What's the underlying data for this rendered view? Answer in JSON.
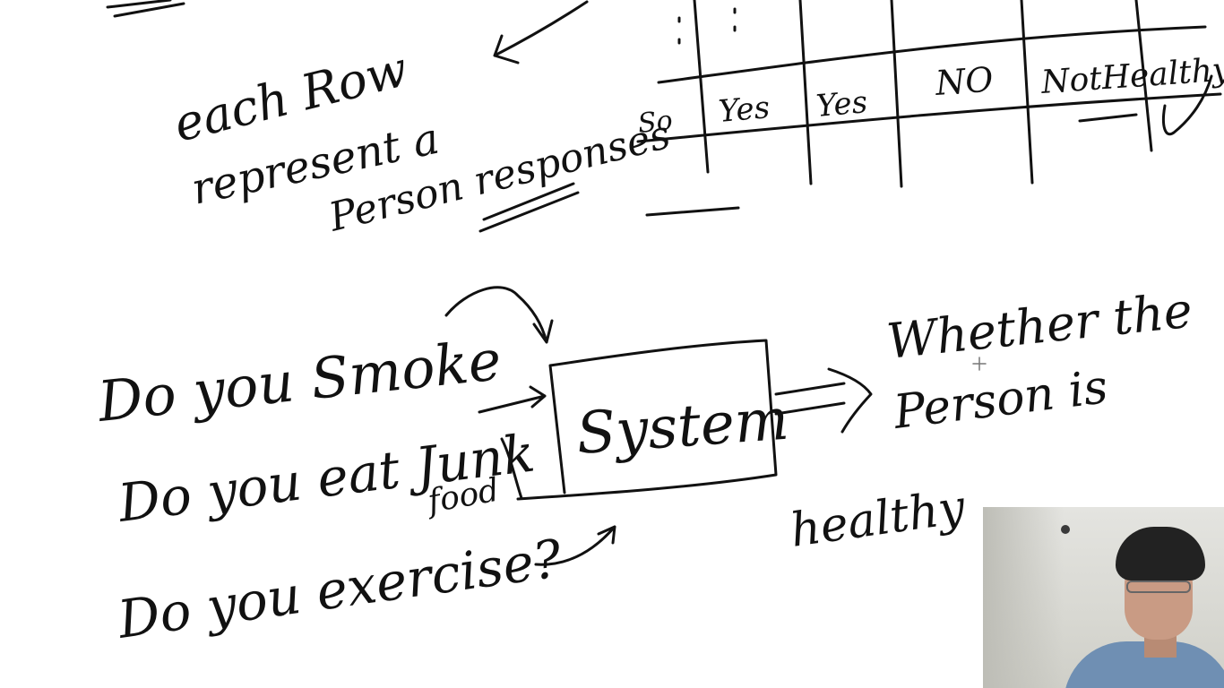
{
  "annotation": {
    "line1": "each Row",
    "line2": "represent a",
    "line3": "Person responses"
  },
  "table_row": [
    "So",
    "Yes",
    "Yes",
    "NO",
    "NotHealthy"
  ],
  "questions": {
    "q1": "Do you Smoke",
    "q2": "Do you eat Junk",
    "q2b": "food",
    "q3": "Do you exercise?"
  },
  "system_label": "System",
  "output": {
    "line1": "Whether the",
    "line2": "Person is",
    "line3": "healthy"
  },
  "colors": {
    "ink": "#111111",
    "board": "#ffffff"
  }
}
